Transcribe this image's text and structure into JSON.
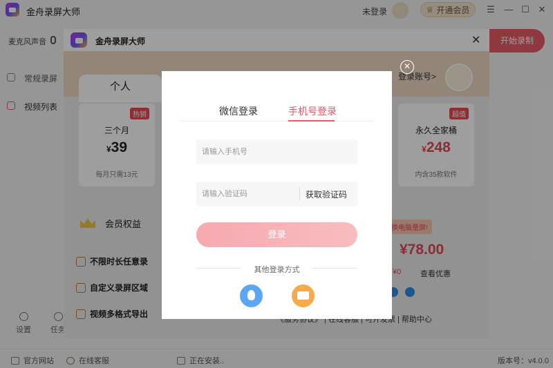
{
  "app": {
    "title": "金舟录屏大师",
    "login_status": "未登录",
    "vip_button": "开通会员"
  },
  "sidebar": {
    "mic_label": "麦克风声音",
    "items": [
      {
        "label": "常规录屏",
        "icon": "record-icon"
      },
      {
        "label": "视频列表",
        "icon": "list-icon"
      }
    ],
    "bottom": [
      {
        "label": "设置",
        "icon": "gear-icon"
      },
      {
        "label": "任务",
        "icon": "task-icon"
      }
    ],
    "start_record": "开始录制"
  },
  "statusbar": {
    "website": "官方网站",
    "service": "在线客服",
    "installing": "正在安装..",
    "version": "版本号：v4.0.0"
  },
  "buy_dialog": {
    "title": "金舟录屏大师",
    "personal_tab": "个人",
    "login_account": "登录账号>",
    "cards": [
      {
        "badge": "热销",
        "name": "三个月",
        "currency": "¥",
        "price": "39",
        "note": "每月只需13元"
      },
      {
        "badge": "超值",
        "name": "永久全家桶",
        "currency": "¥",
        "price": "248",
        "note": "内含35款软件"
      }
    ],
    "benefits_title": "会员权益",
    "benefits": [
      "不限时长任意录",
      "自定义录屏区域",
      "视频多格式导出"
    ],
    "promo_tag": "换电脑量屏!",
    "promo_price": "¥78.00",
    "promo_zero": "¥0",
    "promo_link": "查看优惠",
    "footer_links": "《服务协议》 | 在线客服 | 可开发票 | 帮助中心"
  },
  "login": {
    "tabs": [
      "微信登录",
      "手机号登录"
    ],
    "active_tab": 1,
    "phone_placeholder": "请输入手机号",
    "code_placeholder": "请输入验证码",
    "get_code": "获取验证码",
    "submit": "登录",
    "other_methods": "其他登录方式",
    "social": [
      {
        "name": "qq",
        "icon": "qq-icon",
        "color": "#5aa7f5"
      },
      {
        "name": "mail",
        "icon": "mail-icon",
        "color": "#f8a94a"
      }
    ]
  },
  "colors": {
    "accent": "#e05a67",
    "login_button": "#f6aab0"
  }
}
